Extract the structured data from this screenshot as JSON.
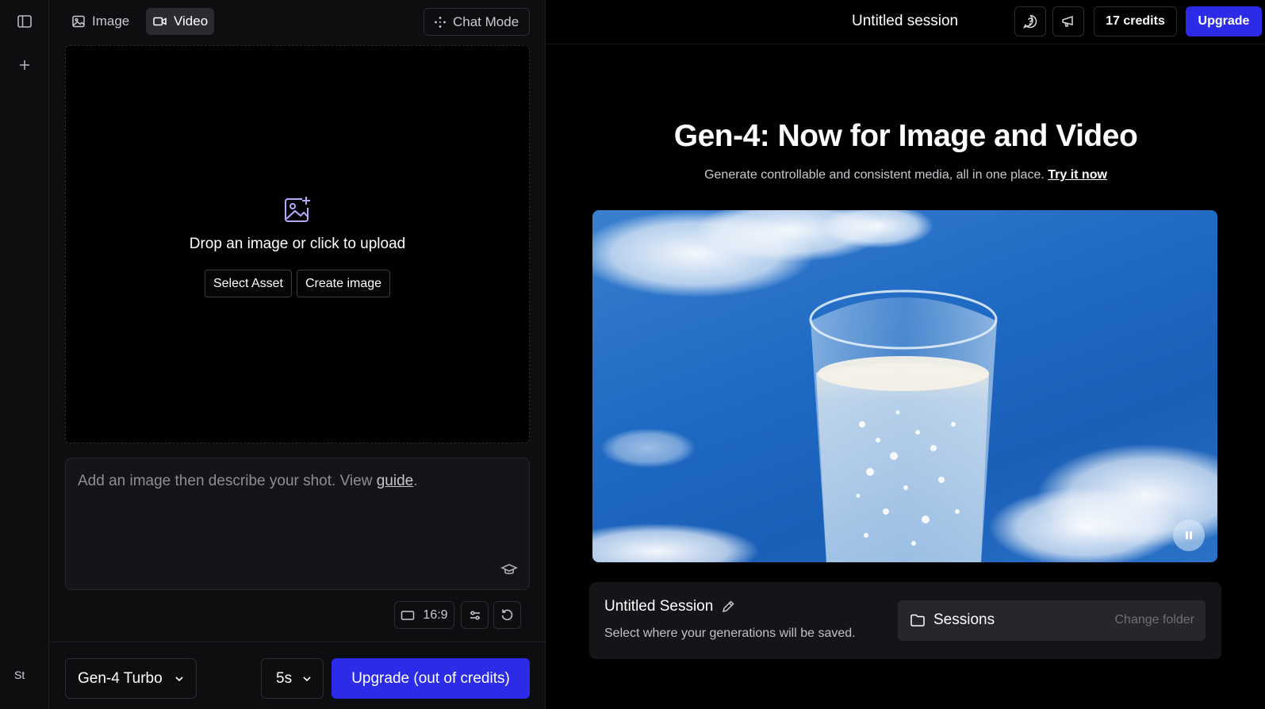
{
  "rail": {
    "bottom_label": "St"
  },
  "left": {
    "tabs": [
      {
        "label": "Image",
        "icon": "image-icon",
        "active": false
      },
      {
        "label": "Video",
        "icon": "video-icon",
        "active": true
      }
    ],
    "chat_mode_label": "Chat Mode",
    "dropzone": {
      "text": "Drop an image or click to upload",
      "select_asset": "Select Asset",
      "create_image": "Create image"
    },
    "prompt": {
      "placeholder_before": "Add an image then describe your shot. View ",
      "guide_link": "guide",
      "placeholder_after": "."
    },
    "tools": {
      "aspect_ratio": "16:9"
    },
    "bottom": {
      "model": "Gen-4 Turbo",
      "duration": "5s",
      "upgrade_label": "Upgrade (out of credits)"
    }
  },
  "right": {
    "session_title": "Untitled session",
    "credits": "17 credits",
    "upgrade_label": "Upgrade",
    "hero": {
      "title": "Gen-4: Now for Image and Video",
      "subtitle": "Generate controllable and consistent media, all in one place.",
      "try_link": "Try it now"
    },
    "session_card": {
      "title": "Untitled Session",
      "subtitle": "Select where your generations will be saved.",
      "folder": "Sessions",
      "change_folder": "Change folder"
    }
  },
  "colors": {
    "accent": "#2b2be8",
    "background": "#000000",
    "panel": "#0d0e10"
  }
}
